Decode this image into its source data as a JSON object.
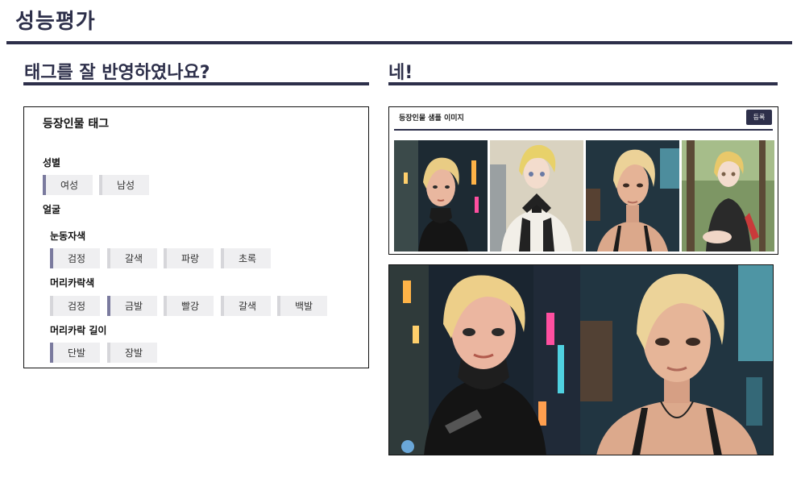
{
  "page_title": "성능평가",
  "left_heading": "태그를 잘 반영하였나요?",
  "right_heading": "네!",
  "panel": {
    "title": "등장인물 태그",
    "gender_label": "성별",
    "gender": [
      "여성",
      "남성"
    ],
    "face_label": "얼굴",
    "eye_label": "눈동자색",
    "eye": [
      "검정",
      "갈색",
      "파랑",
      "초록"
    ],
    "hair_color_label": "머리카락색",
    "hair_color": [
      "검정",
      "금발",
      "빨강",
      "갈색",
      "백발"
    ],
    "hair_length_label": "머리카락 길이",
    "hair_length": [
      "단발",
      "장발"
    ]
  },
  "sample": {
    "title": "등장인물 샘플 이미지",
    "register": "등록"
  },
  "colors": {
    "navy": "#2d2f4a",
    "chip_bg": "#efeff1",
    "chip_selected_bar": "#7a7a9e"
  }
}
